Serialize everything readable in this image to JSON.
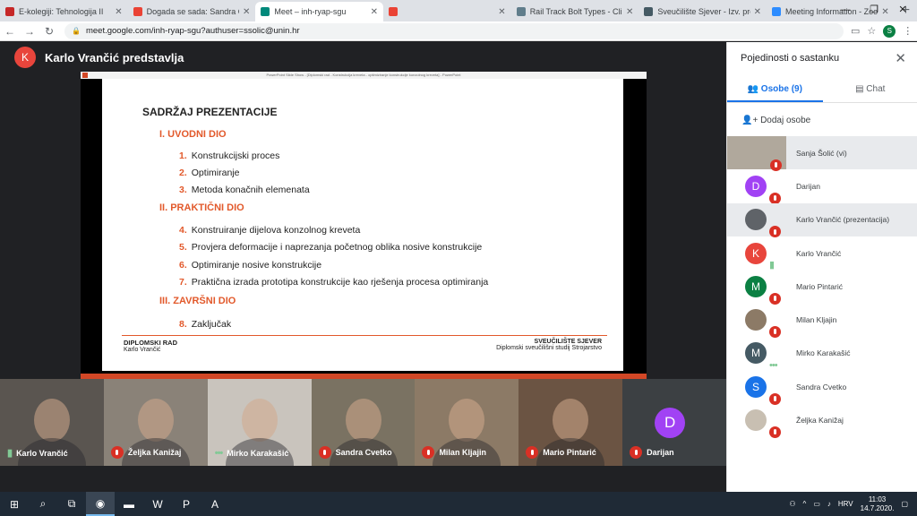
{
  "browser": {
    "tabs": [
      {
        "title": "E-kolegiji: Tehnologija II",
        "color": "#c62828",
        "active": false
      },
      {
        "title": "Dogada se sada: Sandra Cvet",
        "color": "#ea4335",
        "active": false
      },
      {
        "title": "Meet – inh-ryap-sgu",
        "color": "#00897b",
        "active": true
      },
      {
        "title": "",
        "color": "#ea4335",
        "active": false
      },
      {
        "title": "Rail Track Bolt Types - Clip B",
        "color": "#607d8b",
        "active": false
      },
      {
        "title": "Sveučilište Sjever - Izv. prof.",
        "color": "#455a64",
        "active": false
      },
      {
        "title": "Meeting Information - Zoom",
        "color": "#2d8cff",
        "active": false
      }
    ],
    "url": "meet.google.com/inh-ryap-sgu?authuser=ssolic@unin.hr",
    "profile_initial": "S"
  },
  "meet": {
    "presenter_initial": "K",
    "presenter_label": "Karlo Vrančić predstavlja",
    "ppt_title": "PowerPoint Slide Show - [Diplomski rad - Konstrukcija kreveta - optimiziranje konstrukcije konzolnog kreveta] - PowerPoint",
    "slide": {
      "heading": "SADRŽAJ PREZENTACIJE",
      "sections": [
        {
          "title": "I. UVODNI DIO",
          "items": [
            {
              "n": "1.",
              "text": "Konstrukcijski proces"
            },
            {
              "n": "2.",
              "text": "Optimiranje"
            },
            {
              "n": "3.",
              "text": "Metoda konačnih elemenata"
            }
          ]
        },
        {
          "title": "II. PRAKTIČNI DIO",
          "items": [
            {
              "n": "4.",
              "text": "Konstruiranje dijelova konzolnog kreveta"
            },
            {
              "n": "5.",
              "text": "Provjera deformacije i naprezanja početnog oblika nosive konstrukcije"
            },
            {
              "n": "6.",
              "text": "Optimiranje nosive konstrukcije"
            },
            {
              "n": "7.",
              "text": "Praktična izrada prototipa konstrukcije kao rješenja procesa optimiranja"
            }
          ]
        },
        {
          "title": "III. ZAVRŠNI DIO",
          "items": [
            {
              "n": "8.",
              "text": "Zaključak"
            }
          ]
        }
      ],
      "footer_left_title": "DIPLOMSKI RAD",
      "footer_left_sub": "Karlo Vrančić",
      "footer_right_title": "SVEUČILIŠTE SJEVER",
      "footer_right_sub": "Diplomski sveučilišni studij Strojarstvo"
    },
    "tiles": [
      {
        "name": "Karlo Vrančić",
        "status": "speaking",
        "bg": "#5a5550"
      },
      {
        "name": "Željka Kanižaj",
        "status": "muted",
        "bg": "#8a8278"
      },
      {
        "name": "Mirko Karakašić",
        "status": "dots",
        "bg": "#c9c4bd"
      },
      {
        "name": "Sandra Cvetko",
        "status": "muted",
        "bg": "#7a7262"
      },
      {
        "name": "Milan Kljajin",
        "status": "muted",
        "bg": "#8c7a66"
      },
      {
        "name": "Mario Pintarić",
        "status": "muted",
        "bg": "#6b5443"
      },
      {
        "name": "Darijan",
        "status": "muted",
        "bg": "#3c4043",
        "initial": "D"
      }
    ]
  },
  "panel": {
    "title": "Pojedinosti o sastanku",
    "tab_people": "Osobe (9)",
    "tab_chat": "Chat",
    "add_people": "Dodaj osobe",
    "people": [
      {
        "name": "Sanja Šolić (vi)",
        "initial": "",
        "color": "#b0a89c",
        "status": "muted"
      },
      {
        "name": "Darijan",
        "initial": "D",
        "color": "#a142f4",
        "status": "muted"
      },
      {
        "name": "Karlo Vrančić (prezentacija)",
        "initial": "",
        "color": "#5f6368",
        "status": "muted"
      },
      {
        "name": "Karlo Vrančić",
        "initial": "K",
        "color": "#e8453c",
        "status": "speaking"
      },
      {
        "name": "Mario Pintarić",
        "initial": "M",
        "color": "#0b8043",
        "status": "muted"
      },
      {
        "name": "Milan Kljajin",
        "initial": "",
        "color": "#8c7a66",
        "status": "muted"
      },
      {
        "name": "Mirko Karakašić",
        "initial": "M",
        "color": "#455a64",
        "status": "dots"
      },
      {
        "name": "Sandra Cvetko",
        "initial": "S",
        "color": "#1a73e8",
        "status": "muted"
      },
      {
        "name": "Željka Kanižaj",
        "initial": "",
        "color": "#c8bfb2",
        "status": "muted"
      }
    ]
  },
  "taskbar": {
    "lang": "HRV",
    "time": "11:03",
    "date": "14.7.2020."
  }
}
